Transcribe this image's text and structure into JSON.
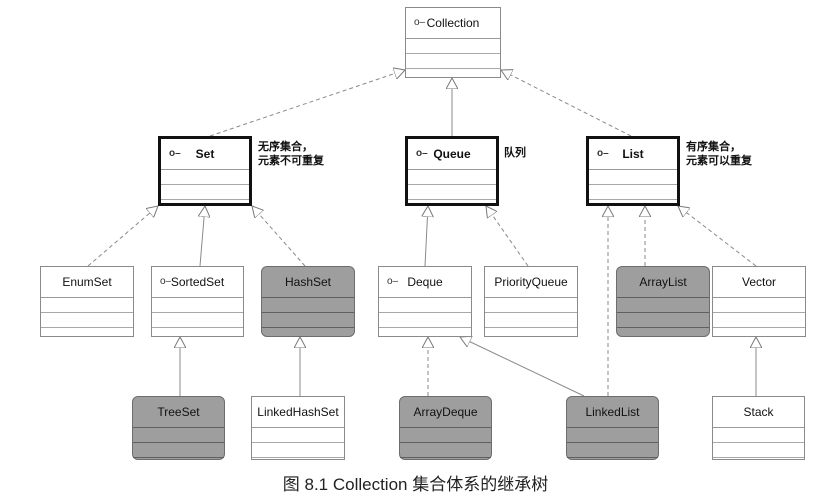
{
  "interface_mark": "o–",
  "nodes": {
    "collection": "Collection",
    "set": "Set",
    "queue": "Queue",
    "list": "List",
    "enumset": "EnumSet",
    "sortedset": "SortedSet",
    "hashset": "HashSet",
    "deque": "Deque",
    "priorityqueue": "PriorityQueue",
    "arraylist": "ArrayList",
    "vector": "Vector",
    "treeset": "TreeSet",
    "linkedhashset": "LinkedHashSet",
    "arraydeque": "ArrayDeque",
    "linkedlist": "LinkedList",
    "stack": "Stack"
  },
  "notes": {
    "set_line1": "无序集合，",
    "set_line2": "元素不可重复",
    "queue": "队列",
    "list_line1": "有序集合，",
    "list_line2": "元素可以重复"
  },
  "caption": "图 8.1    Collection 集合体系的继承树",
  "colors": {
    "shaded_fill": "#9e9e9e",
    "edge": "#8a8a8a",
    "bold_border": "#111111"
  }
}
